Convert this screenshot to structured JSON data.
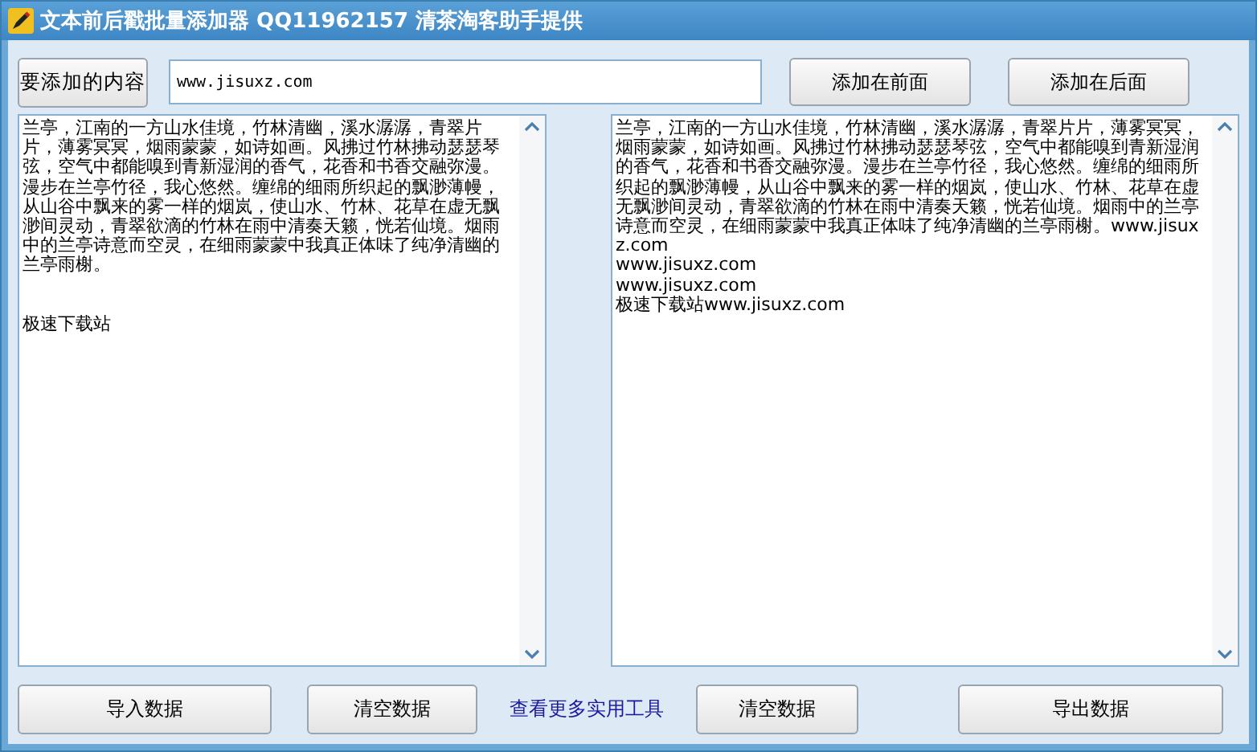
{
  "window": {
    "title": "文本前后戳批量添加器 QQ11962157 清茶淘客助手提供"
  },
  "content_label": "要添加的内容",
  "content_input": {
    "value": "www.jisuxz.com"
  },
  "top_buttons": [
    "添加在前面",
    "添加在后面"
  ],
  "left_text": {
    "lines": [
      "兰亭，江南的一方山水佳境，竹林清幽，溪水潺潺，青翠片片，薄雾冥冥，烟雨蒙蒙，如诗如画。风拂过竹林拂动瑟瑟琴弦，空气中都能嗅到青新湿润的香气，花香和书香交融弥漫。漫步在兰亭竹径，我心悠然。缠绵的细雨所织起的飘渺薄幔，从山谷中飘来的雾一样的烟岚，使山水、竹林、花草在虚无飘渺间灵动，青翠欲滴的竹林在雨中清奏天籁，恍若仙境。烟雨中的兰亭诗意而空灵，在细雨蒙蒙中我真正体味了纯净清幽的兰亭雨榭。",
      "极速下载站"
    ]
  },
  "right_text": {
    "lines": [
      "兰亭，江南的一方山水佳境，竹林清幽，溪水潺潺，青翠片片，薄雾冥冥，烟雨蒙蒙，如诗如画。风拂过竹林拂动瑟瑟琴弦，空气中都能嗅到青新湿润的香气，花香和书香交融弥漫。漫步在兰亭竹径，我心悠然。缠绵的细雨所织起的飘渺薄幔，从山谷中飘来的雾一样的烟岚，使山水、竹林、花草在虚无飘渺间灵动，青翠欲滴的竹林在雨中清奏天籁，恍若仙境。烟雨中的兰亭诗意而空灵，在细雨蒙蒙中我真正体味了纯净清幽的兰亭雨榭。www.jisuxz.com",
      "www.jisuxz.com",
      "www.jisuxz.com",
      "极速下载站www.jisuxz.com"
    ]
  },
  "bottom": [
    {
      "kind": "button",
      "label": "导入数据"
    },
    {
      "kind": "button",
      "label": "清空数据"
    },
    {
      "kind": "link",
      "label": "查看更多实用工具"
    },
    {
      "kind": "button",
      "label": "清空数据"
    },
    {
      "kind": "button",
      "label": "导出数据"
    }
  ]
}
